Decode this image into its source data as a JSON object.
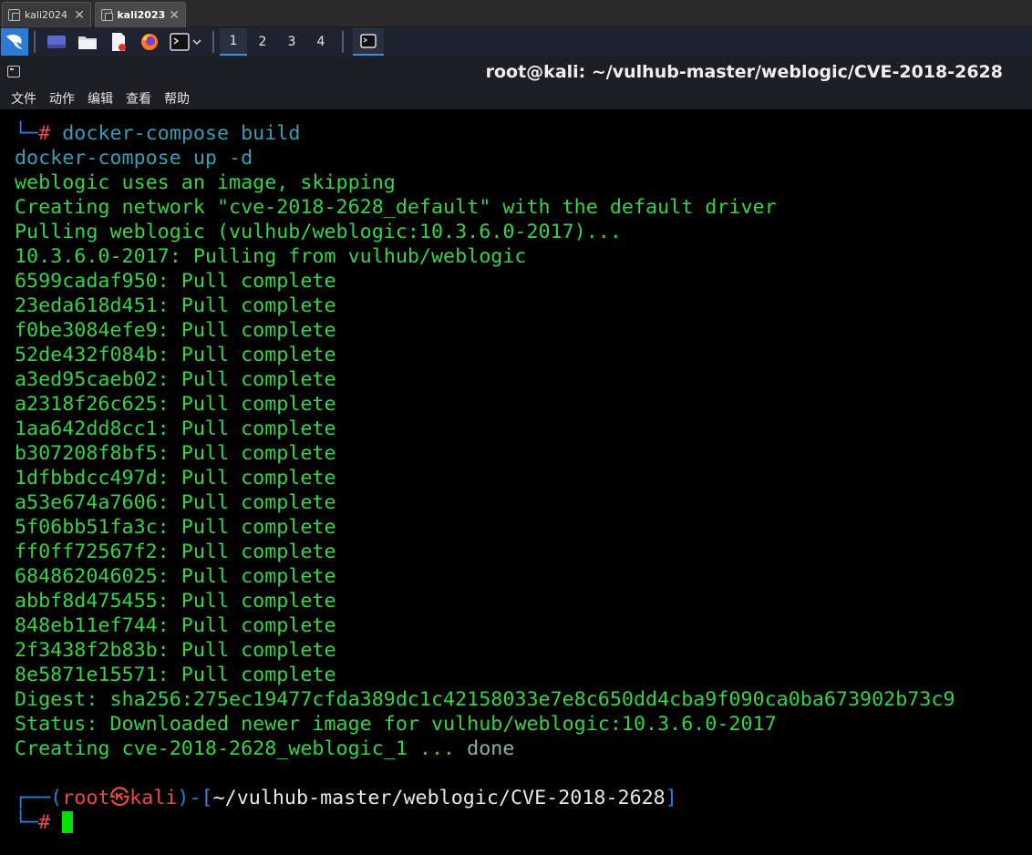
{
  "vm_tabs": [
    {
      "label": "kali2024",
      "close": "✕"
    },
    {
      "label": "kali2023",
      "close": "✕"
    }
  ],
  "panel": {
    "workspaces": [
      "1",
      "2",
      "3",
      "4"
    ],
    "active_workspace": "1"
  },
  "window": {
    "title": "root@kali: ~/vulhub-master/weblogic/CVE-2018-2628",
    "menu": [
      "文件",
      "动作",
      "编辑",
      "查看",
      "帮助"
    ]
  },
  "terminal": {
    "prompt_corner": "└─",
    "prompt_hash": "#",
    "cmd1": " docker-compose build",
    "cmd2": "docker-compose up -d",
    "output": [
      "weblogic uses an image, skipping",
      "Creating network \"cve-2018-2628_default\" with the default driver",
      "Pulling weblogic (vulhub/weblogic:10.3.6.0-2017)...",
      "10.3.6.0-2017: Pulling from vulhub/weblogic",
      "6599cadaf950: Pull complete",
      "23eda618d451: Pull complete",
      "f0be3084efe9: Pull complete",
      "52de432f084b: Pull complete",
      "a3ed95caeb02: Pull complete",
      "a2318f26c625: Pull complete",
      "1aa642dd8cc1: Pull complete",
      "b307208f8bf5: Pull complete",
      "1dfbbdcc497d: Pull complete",
      "a53e674a7606: Pull complete",
      "5f06bb51fa3c: Pull complete",
      "ff0ff72567f2: Pull complete",
      "684862046025: Pull complete",
      "abbf8d475455: Pull complete",
      "848eb11ef744: Pull complete",
      "2f3438f2b83b: Pull complete",
      "8e5871e15571: Pull complete",
      "Digest: sha256:275ec19477cfda389dc1c42158033e7e8c650dd4cba9f090ca0ba673902b73c9",
      "Status: Downloaded newer image for vulhub/weblogic:10.3.6.0-2017"
    ],
    "creating_text": "Creating cve-2018-2628_weblogic_1 ... ",
    "done_text": "done",
    "prompt": {
      "top_left": "┌──(",
      "user": "root",
      "at": "㉿",
      "host": "kali",
      "mid": ")-[",
      "path": "~/vulhub-master/weblogic/CVE-2018-2628",
      "end": "]"
    }
  }
}
